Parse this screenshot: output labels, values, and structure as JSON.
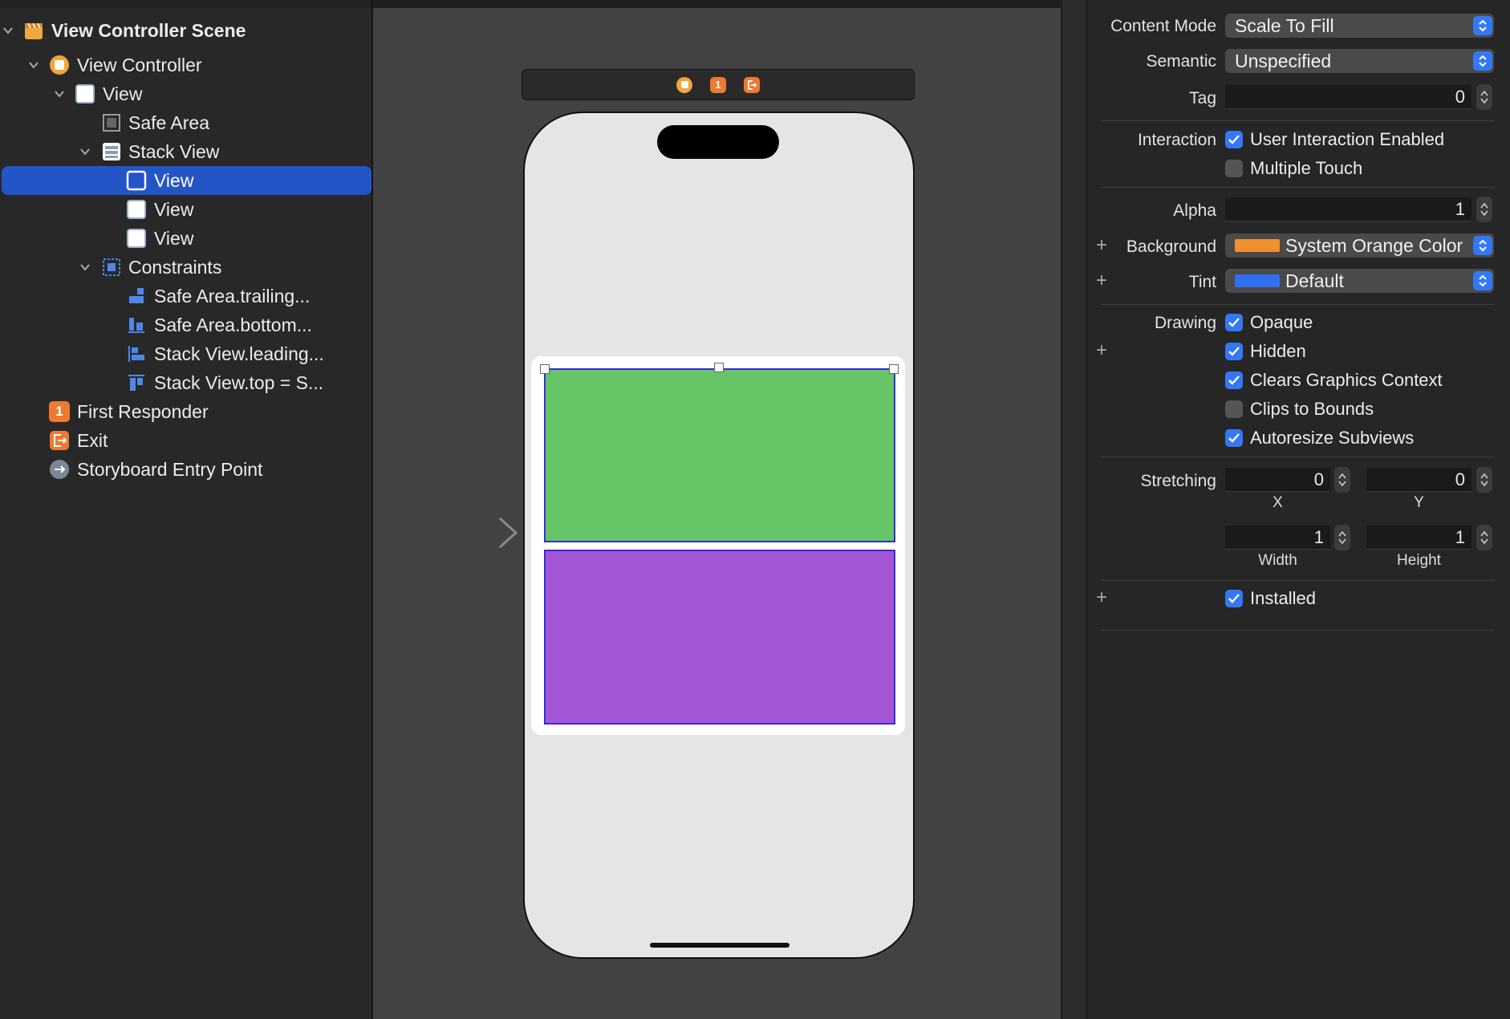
{
  "navigator": {
    "items": [
      {
        "label": "View Controller Scene"
      },
      {
        "label": "View Controller"
      },
      {
        "label": "View"
      },
      {
        "label": "Safe Area"
      },
      {
        "label": "Stack View"
      },
      {
        "label": "View"
      },
      {
        "label": "View"
      },
      {
        "label": "View"
      },
      {
        "label": "Constraints"
      },
      {
        "label": "Safe Area.trailing..."
      },
      {
        "label": "Safe Area.bottom..."
      },
      {
        "label": "Stack View.leading..."
      },
      {
        "label": "Stack View.top = S..."
      },
      {
        "label": "First Responder"
      },
      {
        "label": "Exit"
      },
      {
        "label": "Storyboard Entry Point"
      }
    ],
    "first_responder_badge": "1"
  },
  "canvas": {
    "scene_bar_badge": "1",
    "views": [
      {
        "color": "#65c466"
      },
      {
        "color": "#a356d6"
      }
    ]
  },
  "inspector": {
    "content_mode": {
      "label": "Content Mode",
      "value": "Scale To Fill"
    },
    "semantic": {
      "label": "Semantic",
      "value": "Unspecified"
    },
    "tag": {
      "label": "Tag",
      "value": "0"
    },
    "interaction": {
      "label": "Interaction",
      "user_interaction": "User Interaction Enabled",
      "multiple_touch": "Multiple Touch"
    },
    "alpha": {
      "label": "Alpha",
      "value": "1"
    },
    "background": {
      "label": "Background",
      "value": "System Orange Color",
      "color": "#f0902e"
    },
    "tint": {
      "label": "Tint",
      "value": "Default",
      "color": "#2f6ff0"
    },
    "drawing": {
      "label": "Drawing",
      "opaque": "Opaque",
      "hidden": "Hidden",
      "clears": "Clears Graphics Context",
      "clips": "Clips to Bounds",
      "autoresize": "Autoresize Subviews"
    },
    "stretching": {
      "label": "Stretching",
      "x": "0",
      "y": "0",
      "width": "1",
      "height": "1",
      "x_label": "X",
      "y_label": "Y",
      "width_label": "Width",
      "height_label": "Height"
    },
    "installed": "Installed"
  }
}
